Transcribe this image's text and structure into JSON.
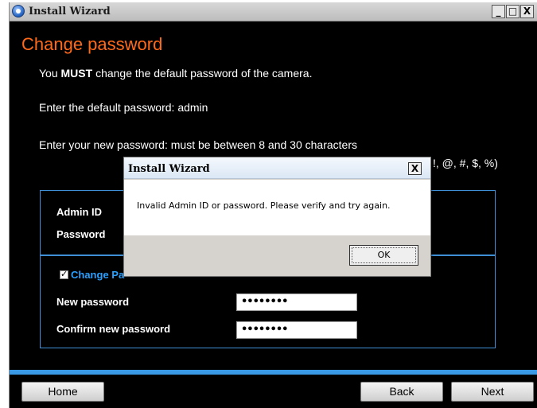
{
  "window": {
    "title": "Install Wizard",
    "minimize_glyph": "_",
    "maximize_glyph": "□",
    "close_glyph": "X"
  },
  "page": {
    "heading": "Change password",
    "line1_prefix": "You ",
    "line1_strong": "MUST",
    "line1_suffix": " change the default password of the camera.",
    "line2": "Enter the default password: admin",
    "line3": "Enter your new password: must be between 8 and 30 characters",
    "line4_partial": "!, @, #, $, %)"
  },
  "form": {
    "admin_id_label": "Admin ID",
    "password_label": "Password",
    "change_password_label": "Change Pa",
    "change_password_checked": true,
    "new_password_label": "New password",
    "new_password_value": "••••••••",
    "confirm_password_label": "Confirm new password",
    "confirm_password_value": "••••••••"
  },
  "footer": {
    "home_label": "Home",
    "back_label": "Back",
    "next_label": "Next"
  },
  "dialog": {
    "title": "Install Wizard",
    "close_glyph": "X",
    "message": "Invalid Admin ID or password. Please verify and try again.",
    "ok_label": "OK"
  },
  "colors": {
    "background": "#000000",
    "heading": "#ff6a1a",
    "accent_blue": "#3a9ae6",
    "change_password_label": "#2aa0ff"
  }
}
